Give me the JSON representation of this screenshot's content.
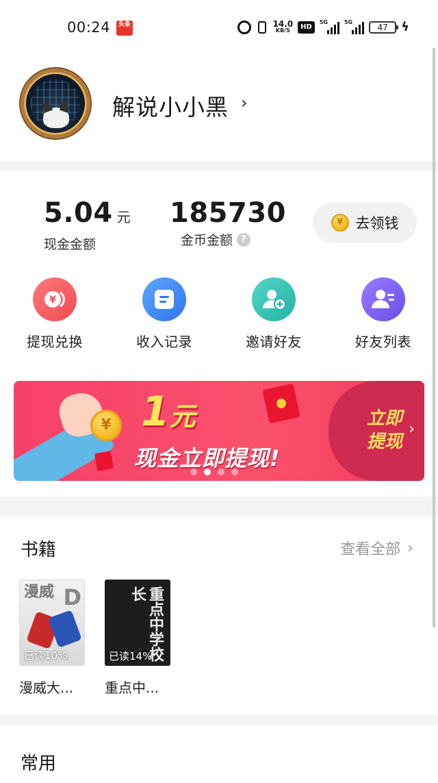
{
  "status_bar": {
    "time": "00:24",
    "app_badge": "头条",
    "net_speed_value": "14.0",
    "net_speed_unit": "KB/S",
    "hd_label": "HD",
    "sim1_label": "5G",
    "sim2_label": "5G",
    "battery": "47"
  },
  "profile": {
    "username": "解说小小黑"
  },
  "wallet": {
    "cash_value": "5.04",
    "cash_unit": "元",
    "cash_label": "现金金额",
    "coin_value": "185730",
    "coin_label": "金币金额",
    "get_money_label": "去领钱",
    "coin_symbol": "¥"
  },
  "actions": [
    {
      "label": "提现兑换",
      "icon": "yuan-coin-icon"
    },
    {
      "label": "收入记录",
      "icon": "document-icon"
    },
    {
      "label": "邀请好友",
      "icon": "add-user-icon"
    },
    {
      "label": "好友列表",
      "icon": "user-list-icon"
    }
  ],
  "banner": {
    "amount": "1",
    "amount_unit": "元",
    "subtitle": "现金立即提现!",
    "cta_line1": "立即",
    "cta_line2": "提现",
    "coin_symbol": "¥",
    "active_slide": 2,
    "slide_count": 4
  },
  "books_section": {
    "title": "书籍",
    "see_all": "查看全部",
    "books": [
      {
        "title": "漫威大...",
        "progress": "已读10%",
        "cover_text": "漫威",
        "cover_letter": "D"
      },
      {
        "title": "重点中...",
        "progress": "已读14%",
        "cover_text": "重点中学校长"
      }
    ]
  },
  "common_section": {
    "title": "常用"
  },
  "colors": {
    "banner_red": "#f8406a",
    "coin_gold": "#f3b51c",
    "action_red": "#f24a55",
    "action_blue": "#2f76f0",
    "action_teal": "#23b3a5",
    "action_purple": "#6a4de8"
  }
}
